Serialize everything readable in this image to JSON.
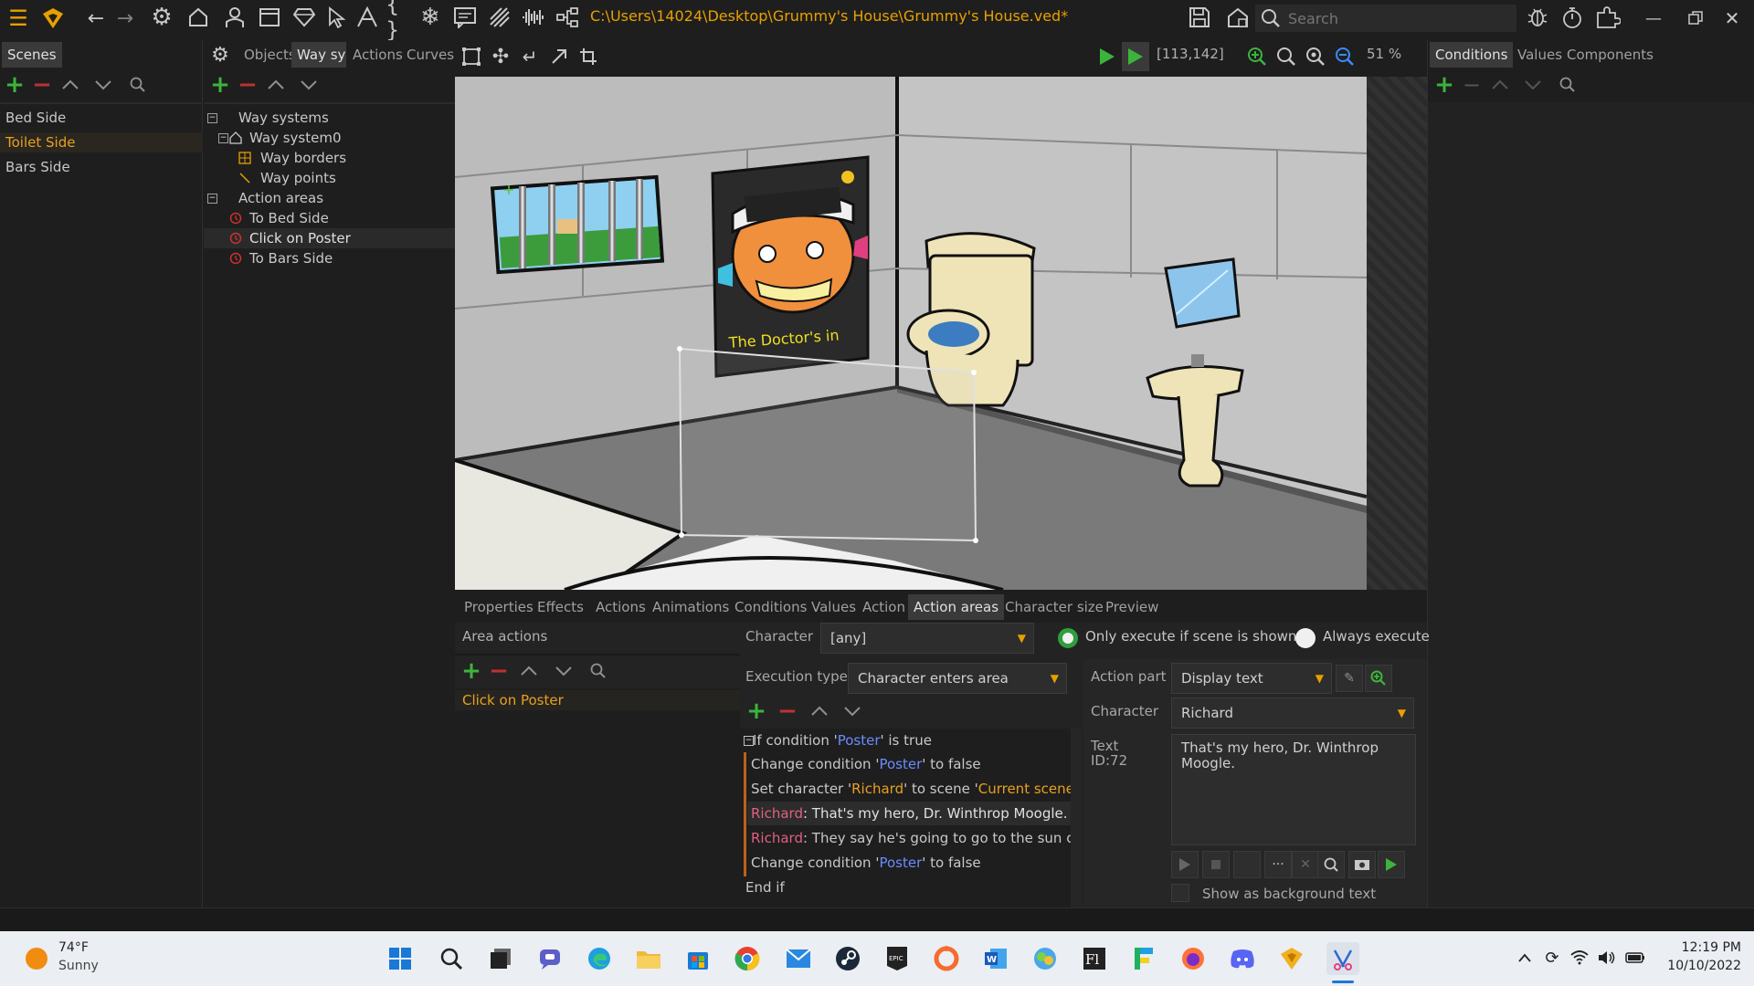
{
  "app": {
    "path": "C:\\Users\\14024\\Desktop\\Grummy's House\\Grummy's House.ved*",
    "search_placeholder": "Search",
    "coords": "[113,142]",
    "zoom": "51 %"
  },
  "left_panel": {
    "tab": "Scenes",
    "scenes": [
      "Bed Side",
      "Toilet Side",
      "Bars Side"
    ]
  },
  "mid_panel": {
    "tabs": [
      "Objects",
      "Way sys",
      "Actions",
      "Curves"
    ],
    "tree": {
      "way_systems": "Way systems",
      "way_system0": "Way system0",
      "way_borders": "Way borders",
      "way_points": "Way points",
      "action_areas": "Action areas",
      "areas": [
        "To Bed Side",
        "Click on Poster",
        "To Bars Side"
      ]
    }
  },
  "right_panel": {
    "tabs": [
      "Conditions",
      "Values",
      "Components"
    ]
  },
  "poster_text": "The Doctor's in",
  "bottom_tabs": [
    "Properties",
    "Effects",
    "Actions",
    "Animations",
    "Conditions",
    "Values",
    "Action",
    "Action areas",
    "Character size",
    "Preview"
  ],
  "area_actions": {
    "title": "Area actions",
    "items": [
      "Click on Poster"
    ]
  },
  "action_config": {
    "character_label": "Character",
    "character_value": "[any]",
    "only_execute": "Only execute if scene is shown",
    "always_execute": "Always execute",
    "execution_type_label": "Execution type",
    "execution_type_value": "Character enters area"
  },
  "script": {
    "if_prefix": "If condition '",
    "if_name": "Poster",
    "if_suffix": "' is true",
    "l1_prefix": "Change condition '",
    "l1_name": "Poster",
    "l1_suffix": "' to false",
    "l2_prefix": "Set character '",
    "l2_char": "Richard",
    "l2_mid": "' to scene '",
    "l2_scene": "Current scene",
    "l2_end": "'",
    "l3_char": "Richard",
    "l3_text": ": That's my hero, Dr. Winthrop Moogle.",
    "l4_char": "Richard",
    "l4_text": ": They say he's going to go to the sun one",
    "l5_prefix": "Change condition '",
    "l5_name": "Poster",
    "l5_suffix": "' to false",
    "end": "End if"
  },
  "action_part": {
    "label": "Action part",
    "value": "Display text",
    "character_label": "Character",
    "character_value": "Richard",
    "text_label": "Text",
    "text_id": "ID:72",
    "text_value": "That's my hero, Dr. Winthrop Moogle.",
    "bg_checkbox": "Show as background text"
  },
  "taskbar": {
    "temp": "74°F",
    "weather": "Sunny",
    "time": "12:19 PM",
    "date": "10/10/2022"
  }
}
